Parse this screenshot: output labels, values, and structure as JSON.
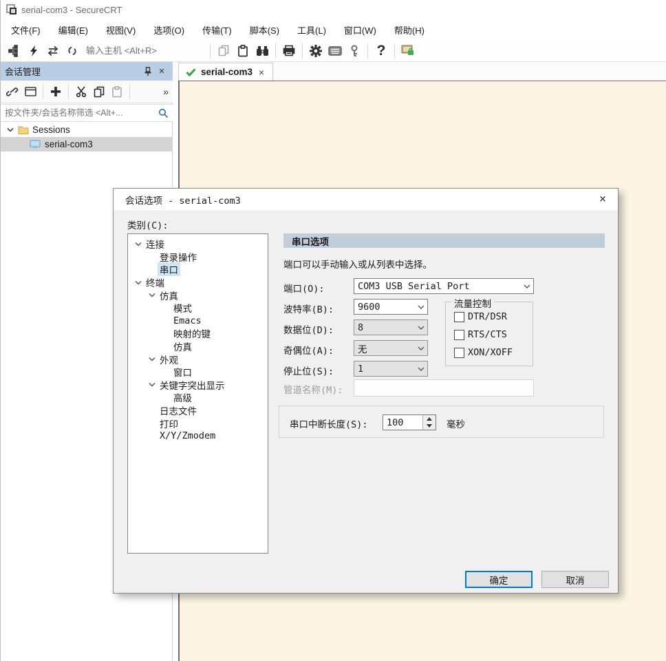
{
  "window": {
    "title": "serial-com3 - SecureCRT"
  },
  "menu_items": [
    "文件(F)",
    "编辑(E)",
    "视图(V)",
    "选项(O)",
    "传输(T)",
    "脚本(S)",
    "工具(L)",
    "窗口(W)",
    "帮助(H)"
  ],
  "toolbar": {
    "host_input_placeholder": "输入主机 <Alt+R>",
    "help_glyph": "?"
  },
  "icons": {
    "help": "?",
    "overflow": "»",
    "close": "×",
    "expander": "v"
  },
  "session_panel": {
    "title": "会话管理",
    "filter_placeholder": "按文件夹/会话名称筛选 <Alt+...",
    "folder_label": "Sessions",
    "session_label": "serial-com3",
    "overflow_label": "»",
    "close_label": "×"
  },
  "tab": {
    "label": "serial-com3",
    "close_label": "×"
  },
  "dialog": {
    "title": "会话选项 - serial-com3",
    "close_label": "×",
    "category_label": "类别(C):",
    "categories": [
      {
        "label": "连接",
        "depth": 0,
        "expanded": true,
        "selected": false
      },
      {
        "label": "登录操作",
        "depth": 1,
        "expanded": false,
        "selected": false
      },
      {
        "label": "串口",
        "depth": 1,
        "expanded": false,
        "selected": true
      },
      {
        "label": "终端",
        "depth": 0,
        "expanded": true,
        "selected": false
      },
      {
        "label": "仿真",
        "depth": 1,
        "expanded": true,
        "selected": false
      },
      {
        "label": "模式",
        "depth": 2,
        "expanded": false,
        "selected": false
      },
      {
        "label": "Emacs",
        "depth": 2,
        "expanded": false,
        "selected": false
      },
      {
        "label": "映射的键",
        "depth": 2,
        "expanded": false,
        "selected": false
      },
      {
        "label": "仿真",
        "depth": 2,
        "expanded": false,
        "selected": false
      },
      {
        "label": "外观",
        "depth": 1,
        "expanded": true,
        "selected": false
      },
      {
        "label": "窗口",
        "depth": 2,
        "expanded": false,
        "selected": false
      },
      {
        "label": "关键字突出显示",
        "depth": 1,
        "expanded": true,
        "selected": false
      },
      {
        "label": "高级",
        "depth": 2,
        "expanded": false,
        "selected": false
      },
      {
        "label": "日志文件",
        "depth": 1,
        "expanded": false,
        "selected": false
      },
      {
        "label": "打印",
        "depth": 1,
        "expanded": false,
        "selected": false
      },
      {
        "label": "X/Y/Zmodem",
        "depth": 1,
        "expanded": false,
        "selected": false
      }
    ],
    "panel": {
      "header": "串口选项",
      "description": "端口可以手动输入或从列表中选择。",
      "port": {
        "label": "端口(O):",
        "value": "COM3 USB Serial Port"
      },
      "baud": {
        "label": "波特率(B):",
        "value": "9600"
      },
      "data_bits": {
        "label": "数据位(D):",
        "value": "8"
      },
      "parity": {
        "label": "奇偶位(A):",
        "value": "无"
      },
      "stop_bits": {
        "label": "停止位(S):",
        "value": "1"
      },
      "pipe_name": {
        "label": "管道名称(M):",
        "value": ""
      },
      "flow_control": {
        "title": "流量控制",
        "options": [
          {
            "label": "DTR/DSR",
            "checked": false
          },
          {
            "label": "RTS/CTS",
            "checked": false
          },
          {
            "label": "XON/XOFF",
            "checked": false
          }
        ]
      },
      "break_length": {
        "label": "串口中断长度(S):",
        "value": "100",
        "unit": "毫秒"
      }
    },
    "buttons": {
      "ok": "确定",
      "cancel": "取消"
    }
  },
  "colors": {
    "accent": "#0078d7",
    "terminal_bg": "#fcf5e3",
    "panel_header_bg": "#b9cee4",
    "section_header_bg": "#c0cedc",
    "tree_selection": "#cde6f7",
    "sidebar_selection": "#d4d4d4",
    "check_green": "#2fa838",
    "folder_yellow": "#f7d576"
  }
}
